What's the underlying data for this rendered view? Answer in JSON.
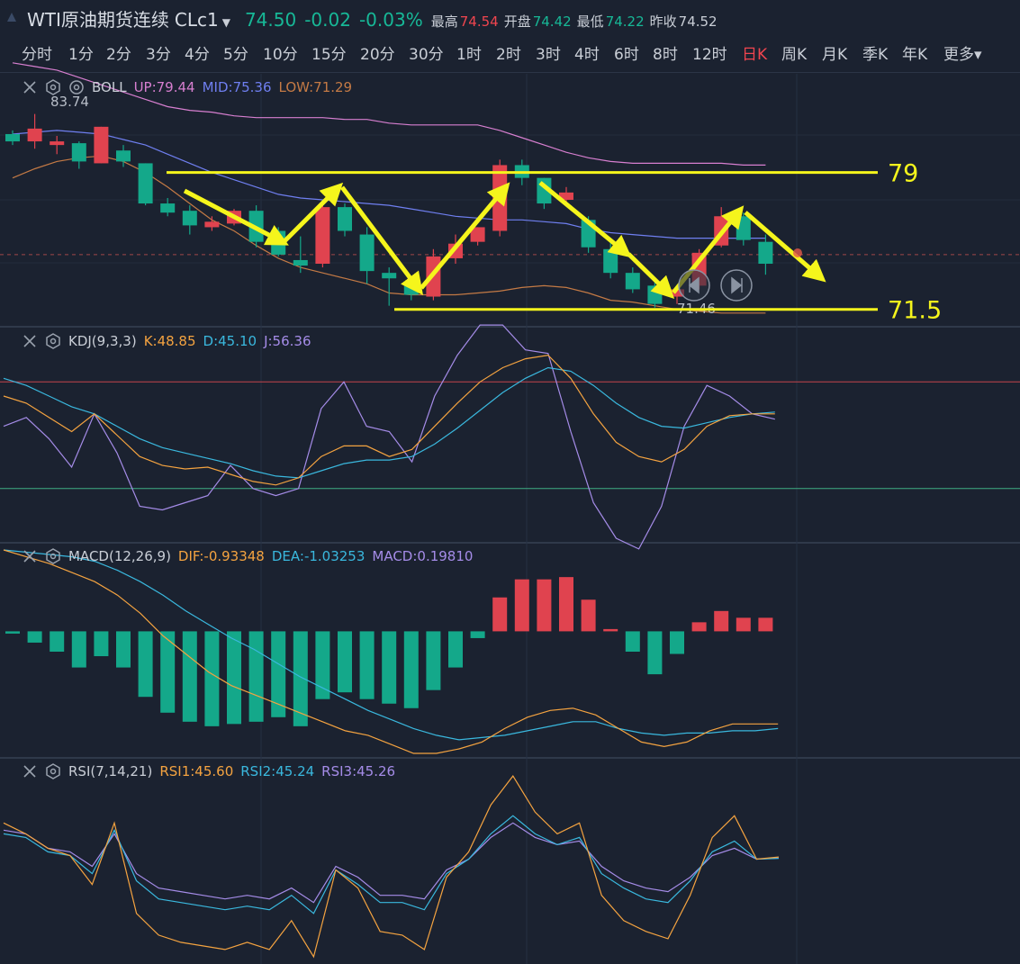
{
  "header": {
    "title": "WTI原油期货连续",
    "code": "CLc1",
    "last": "74.50",
    "change": "-0.02",
    "change_pct": "-0.03%",
    "high_label": "最高",
    "high": "74.54",
    "open_label": "开盘",
    "open": "74.42",
    "low_label": "最低",
    "low": "74.22",
    "prev_label": "昨收",
    "prev": "74.52"
  },
  "periods": [
    "分时",
    "1分",
    "2分",
    "3分",
    "4分",
    "5分",
    "10分",
    "15分",
    "20分",
    "30分",
    "1时",
    "2时",
    "3时",
    "4时",
    "6时",
    "8时",
    "12时",
    "日K",
    "周K",
    "月K",
    "季K",
    "年K",
    "更多"
  ],
  "active_period": "日K",
  "colors": {
    "up": "#e0434f",
    "down": "#14a88a",
    "bg": "#1b2230",
    "boll_up": "#d77fd0",
    "boll_mid": "#6f7ff0",
    "boll_low": "#c47a45",
    "annotation": "#f5f51c"
  },
  "boll": {
    "name": "BOLL",
    "up": "UP:79.44",
    "mid": "MID:75.36",
    "low": "LOW:71.29",
    "max_label": "83.74",
    "min_label": "71.46"
  },
  "kdj": {
    "name": "KDJ(9,3,3)",
    "k": "K:48.85",
    "d": "D:45.10",
    "j": "J:56.36"
  },
  "macd": {
    "name": "MACD(12,26,9)",
    "dif": "DIF:-0.93348",
    "dea": "DEA:-1.03253",
    "macd": "MACD:0.19810"
  },
  "rsi": {
    "name": "RSI(7,14,21)",
    "rsi1": "RSI1:45.60",
    "rsi2": "RSI2:45.24",
    "rsi3": "RSI3:45.26"
  },
  "annotations": {
    "resistance": "79",
    "support": "71.5"
  },
  "chart_data": {
    "type": "candlestick",
    "price_range": [
      70.6,
      84.4
    ],
    "candles": [
      {
        "o": 81.1,
        "c": 80.7,
        "h": 81.3,
        "l": 80.5
      },
      {
        "o": 80.7,
        "c": 81.4,
        "h": 82.2,
        "l": 80.3
      },
      {
        "o": 80.5,
        "c": 80.7,
        "h": 81.0,
        "l": 80.0
      },
      {
        "o": 80.6,
        "c": 79.6,
        "h": 80.7,
        "l": 79.2
      },
      {
        "o": 79.5,
        "c": 81.5,
        "h": 81.5,
        "l": 79.5
      },
      {
        "o": 80.2,
        "c": 79.6,
        "h": 80.5,
        "l": 79.3
      },
      {
        "o": 79.5,
        "c": 77.3,
        "h": 79.5,
        "l": 77.2
      },
      {
        "o": 77.3,
        "c": 76.8,
        "h": 77.6,
        "l": 76.6
      },
      {
        "o": 76.9,
        "c": 76.1,
        "h": 77.2,
        "l": 75.6
      },
      {
        "o": 76.0,
        "c": 76.3,
        "h": 76.6,
        "l": 75.8
      },
      {
        "o": 76.2,
        "c": 76.9,
        "h": 77.0,
        "l": 76.1
      },
      {
        "o": 76.9,
        "c": 75.2,
        "h": 77.2,
        "l": 74.9
      },
      {
        "o": 75.8,
        "c": 74.5,
        "h": 76.0,
        "l": 74.4
      },
      {
        "o": 74.2,
        "c": 73.9,
        "h": 75.5,
        "l": 73.5
      },
      {
        "o": 74.0,
        "c": 77.1,
        "h": 77.2,
        "l": 73.8
      },
      {
        "o": 77.1,
        "c": 75.8,
        "h": 77.3,
        "l": 75.5
      },
      {
        "o": 75.6,
        "c": 73.6,
        "h": 76.0,
        "l": 72.9
      },
      {
        "o": 73.5,
        "c": 73.2,
        "h": 73.8,
        "l": 71.7
      },
      {
        "o": 72.9,
        "c": 72.3,
        "h": 73.2,
        "l": 72.0
      },
      {
        "o": 72.2,
        "c": 74.4,
        "h": 74.8,
        "l": 72.0
      },
      {
        "o": 74.3,
        "c": 75.1,
        "h": 75.6,
        "l": 74.0
      },
      {
        "o": 75.2,
        "c": 76.0,
        "h": 76.0,
        "l": 75.0
      },
      {
        "o": 75.8,
        "c": 79.4,
        "h": 79.7,
        "l": 75.5
      },
      {
        "o": 79.4,
        "c": 78.7,
        "h": 79.7,
        "l": 78.3
      },
      {
        "o": 78.7,
        "c": 77.3,
        "h": 78.7,
        "l": 77.0
      },
      {
        "o": 77.5,
        "c": 77.9,
        "h": 78.2,
        "l": 77.3
      },
      {
        "o": 76.4,
        "c": 74.9,
        "h": 76.6,
        "l": 74.6
      },
      {
        "o": 74.8,
        "c": 73.5,
        "h": 75.3,
        "l": 73.2
      },
      {
        "o": 73.5,
        "c": 72.6,
        "h": 73.8,
        "l": 72.4
      },
      {
        "o": 72.8,
        "c": 71.8,
        "h": 73.0,
        "l": 71.6
      },
      {
        "o": 72.2,
        "c": 72.6,
        "h": 72.8,
        "l": 71.8
      },
      {
        "o": 72.8,
        "c": 74.6,
        "h": 74.8,
        "l": 72.6
      },
      {
        "o": 75.0,
        "c": 76.6,
        "h": 77.1,
        "l": 74.9
      },
      {
        "o": 76.6,
        "c": 75.3,
        "h": 76.8,
        "l": 75.0
      },
      {
        "o": 75.2,
        "c": 74.0,
        "h": 75.6,
        "l": 73.4
      }
    ],
    "boll_up": [
      85.0,
      84.8,
      84.6,
      84.2,
      83.8,
      83.4,
      83.0,
      82.6,
      82.4,
      82.3,
      82.1,
      82.0,
      82.0,
      82.0,
      82.0,
      81.9,
      81.9,
      81.7,
      81.6,
      81.6,
      81.6,
      81.6,
      81.3,
      80.9,
      80.5,
      80.1,
      79.8,
      79.6,
      79.5,
      79.5,
      79.5,
      79.5,
      79.5,
      79.4,
      79.4
    ],
    "boll_mid": [
      81.1,
      81.2,
      81.3,
      81.2,
      81.1,
      80.8,
      80.5,
      80.0,
      79.5,
      79.0,
      78.6,
      78.2,
      77.8,
      77.6,
      77.5,
      77.4,
      77.3,
      77.2,
      77.0,
      76.8,
      76.6,
      76.5,
      76.4,
      76.4,
      76.3,
      76.2,
      75.9,
      75.7,
      75.6,
      75.5,
      75.4,
      75.4,
      75.4,
      75.4,
      75.4
    ],
    "boll_low": [
      78.7,
      79.2,
      79.6,
      79.8,
      79.9,
      79.6,
      79.0,
      78.2,
      77.3,
      76.4,
      75.8,
      75.0,
      74.3,
      73.8,
      73.5,
      73.2,
      72.9,
      72.4,
      72.3,
      72.3,
      72.3,
      72.4,
      72.5,
      72.7,
      72.8,
      72.7,
      72.4,
      72.0,
      71.9,
      71.7,
      71.5,
      71.4,
      71.3,
      71.3,
      71.3
    ],
    "kdj_range": [
      -10,
      110
    ],
    "k": [
      72,
      68,
      60,
      52,
      62,
      50,
      38,
      33,
      31,
      32,
      28,
      24,
      22,
      26,
      38,
      44,
      44,
      38,
      42,
      55,
      68,
      80,
      88,
      93,
      95,
      82,
      62,
      46,
      38,
      35,
      42,
      55,
      61,
      62,
      62
    ],
    "d": [
      82,
      78,
      72,
      66,
      62,
      55,
      48,
      43,
      40,
      37,
      34,
      30,
      27,
      26,
      30,
      34,
      36,
      36,
      38,
      45,
      54,
      64,
      74,
      82,
      88,
      86,
      78,
      68,
      60,
      55,
      54,
      57,
      60,
      62,
      63
    ],
    "j": [
      55,
      60,
      48,
      32,
      62,
      40,
      10,
      8,
      12,
      16,
      33,
      20,
      16,
      20,
      65,
      80,
      55,
      52,
      35,
      72,
      95,
      112,
      112,
      98,
      96,
      52,
      12,
      -8,
      -14,
      10,
      55,
      78,
      72,
      62,
      59
    ],
    "macd_range": [
      -5.6,
      3.8
    ],
    "dif": [
      3.6,
      3.3,
      3.0,
      2.6,
      2.2,
      1.6,
      0.8,
      -0.2,
      -1.0,
      -1.8,
      -2.4,
      -2.8,
      -3.2,
      -3.6,
      -4.0,
      -4.4,
      -4.6,
      -5.0,
      -5.4,
      -5.4,
      -5.2,
      -4.9,
      -4.3,
      -3.8,
      -3.5,
      -3.4,
      -3.7,
      -4.3,
      -4.9,
      -5.1,
      -4.9,
      -4.4,
      -4.1,
      -4.1,
      -4.1
    ],
    "dea": [
      3.6,
      3.5,
      3.4,
      3.3,
      3.1,
      2.7,
      2.2,
      1.6,
      0.9,
      0.3,
      -0.3,
      -0.8,
      -1.4,
      -2.0,
      -2.5,
      -3.0,
      -3.5,
      -3.9,
      -4.3,
      -4.6,
      -4.8,
      -4.7,
      -4.6,
      -4.4,
      -4.2,
      -4.0,
      -4.0,
      -4.3,
      -4.5,
      -4.6,
      -4.5,
      -4.5,
      -4.4,
      -4.4,
      -4.3
    ],
    "macd_hist": [
      -0.1,
      -0.5,
      -0.9,
      -1.6,
      -1.1,
      -1.6,
      -2.9,
      -3.6,
      -4.0,
      -4.2,
      -4.1,
      -4.0,
      -3.8,
      -4.2,
      -3.0,
      -2.7,
      -3.0,
      -3.2,
      -3.4,
      -2.6,
      -1.6,
      -0.3,
      1.5,
      2.3,
      2.3,
      2.4,
      1.4,
      0.1,
      -0.9,
      -1.9,
      -1.0,
      0.4,
      0.9,
      0.6,
      0.6
    ],
    "rsi_range": [
      16,
      72
    ],
    "rsi1": [
      55,
      52,
      48,
      46,
      38,
      55,
      30,
      24,
      22,
      21,
      20,
      22,
      20,
      28,
      18,
      42,
      37,
      25,
      24,
      20,
      40,
      47,
      60,
      68,
      58,
      52,
      55,
      35,
      28,
      25,
      23,
      35,
      51,
      57,
      45,
      45.6
    ],
    "rsi2": [
      52,
      51,
      47,
      46,
      41,
      53,
      39,
      34,
      33,
      32,
      31,
      32,
      31,
      35,
      30,
      42,
      38,
      33,
      33,
      31,
      41,
      45,
      52,
      57,
      52,
      49,
      51,
      41,
      37,
      34,
      33,
      39,
      47,
      50,
      45,
      45.2
    ],
    "rsi3": [
      53,
      52,
      48,
      47,
      43,
      52,
      41,
      37,
      36,
      35,
      34,
      35,
      34,
      37,
      33,
      43,
      40,
      35,
      35,
      34,
      42,
      45,
      51,
      55,
      51,
      49,
      50,
      43,
      39,
      37,
      36,
      40,
      46,
      48,
      45,
      45.3
    ]
  }
}
